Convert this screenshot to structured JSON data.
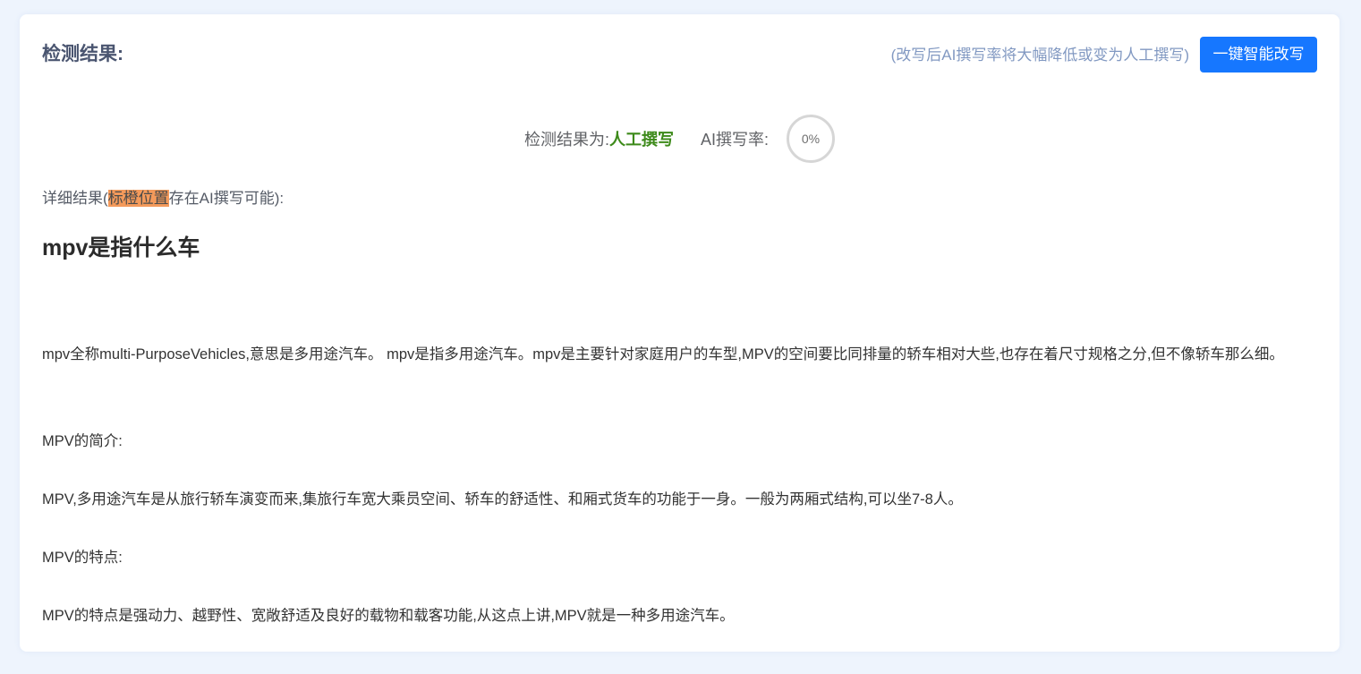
{
  "header": {
    "title": "检测结果:",
    "hint": "(改写后AI撰写率将大幅降低或变为人工撰写)",
    "rewrite_button": "一键智能改写"
  },
  "result": {
    "label": "检测结果为:",
    "value": "人工撰写",
    "rate_label": "AI撰写率:",
    "rate_value": "0%"
  },
  "detail": {
    "prefix": "详细结果(",
    "highlight": "标橙位置",
    "suffix": "存在AI撰写可能):"
  },
  "article": {
    "title": "mpv是指什么车",
    "paragraphs": [
      "mpv全称multi-PurposeVehicles,意思是多用途汽车。 mpv是指多用途汽车。mpv是主要针对家庭用户的车型,MPV的空间要比同排量的轿车相对大些,也存在着尺寸规格之分,但不像轿车那么细。",
      "MPV的简介:",
      "MPV,多用途汽车是从旅行轿车演变而来,集旅行车宽大乘员空间、轿车的舒适性、和厢式货车的功能于一身。一般为两厢式结构,可以坐7-8人。",
      "MPV的特点:",
      "MPV的特点是强动力、越野性、宽敞舒适及良好的载物和载客功能,从这点上讲,MPV就是一种多用途汽车。"
    ]
  },
  "colors": {
    "accent": "#1677ff",
    "human_result": "#3d8a1a",
    "highlight": "#f49a5b"
  }
}
